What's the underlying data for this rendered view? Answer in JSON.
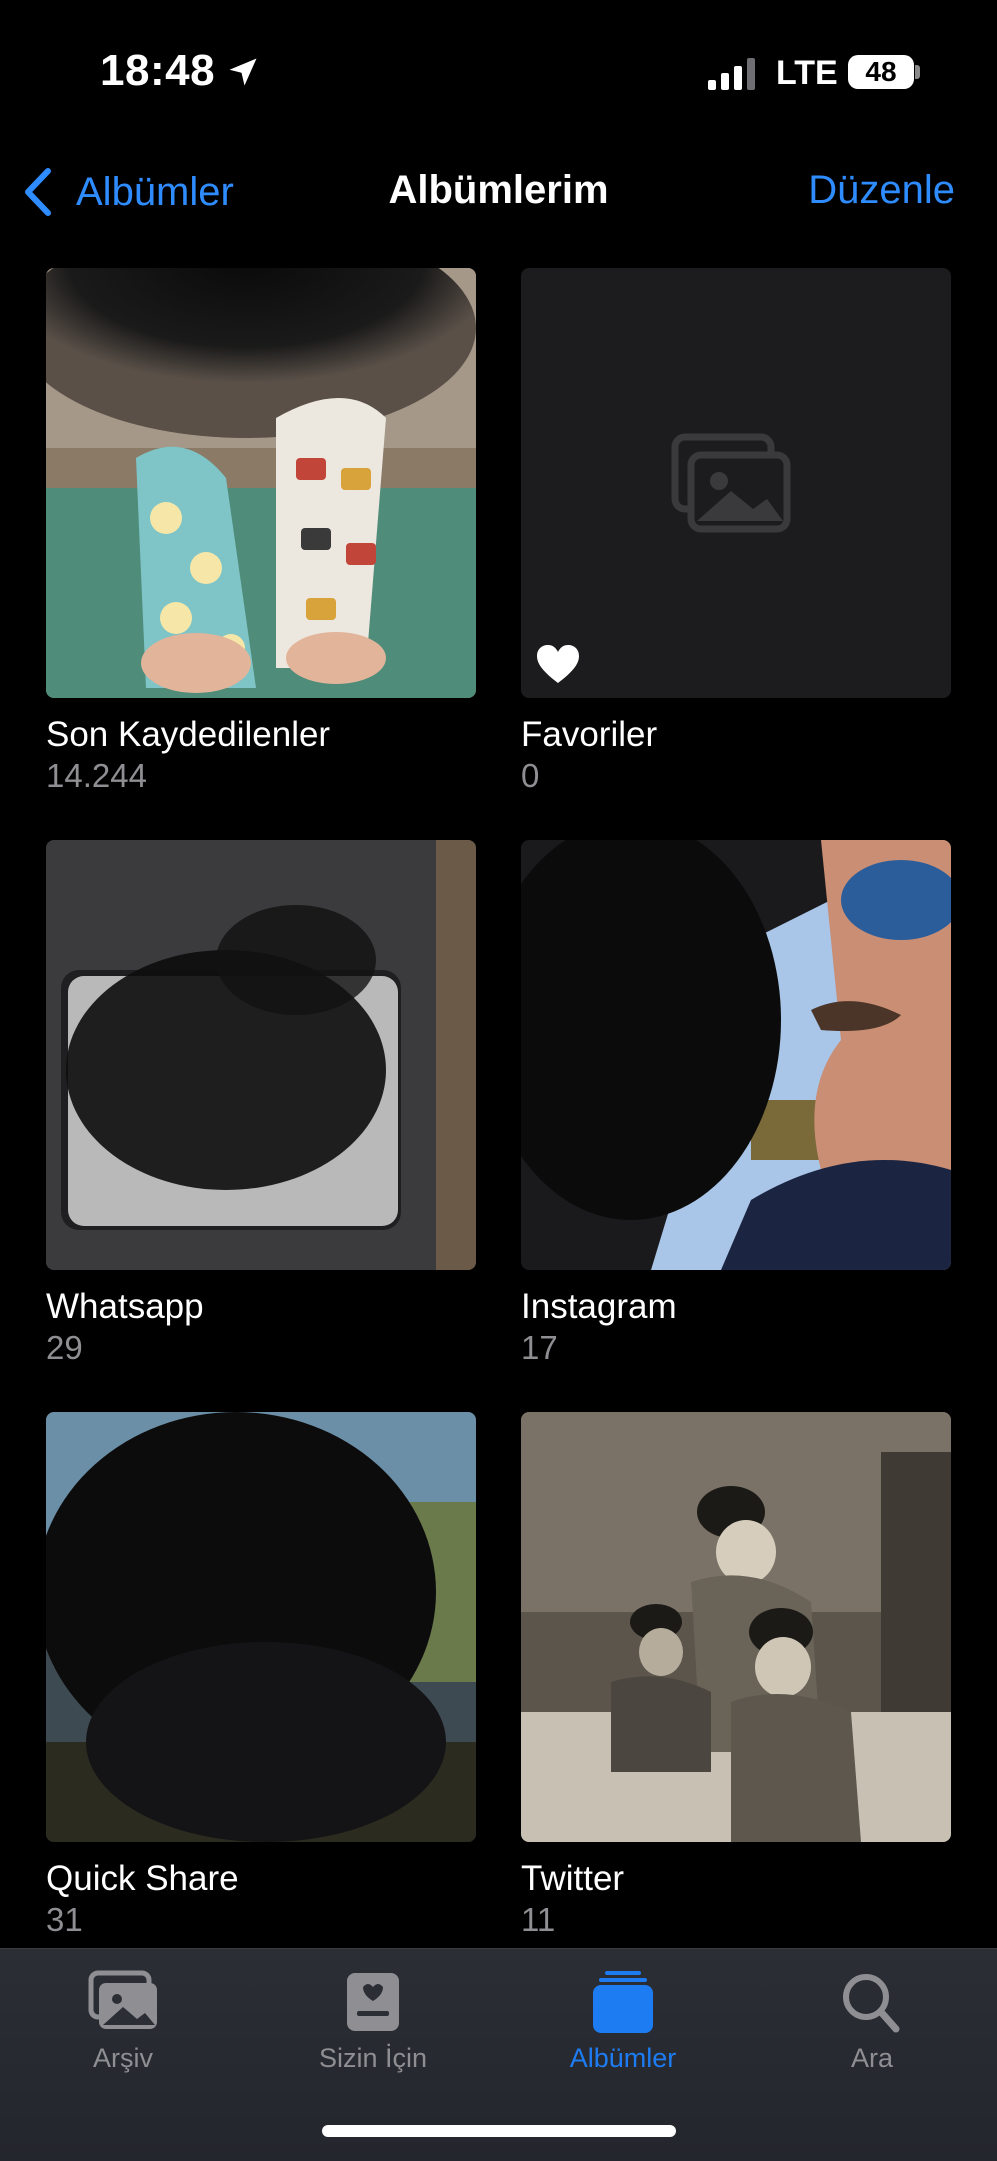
{
  "status_bar": {
    "time": "18:48",
    "network": "LTE",
    "battery": "48"
  },
  "nav": {
    "back_label": "Albümler",
    "title": "Albümlerim",
    "edit_label": "Düzenle"
  },
  "albums": [
    {
      "name": "Son Kaydedilenler",
      "count": "14.244"
    },
    {
      "name": "Favoriler",
      "count": "0"
    },
    {
      "name": "Whatsapp",
      "count": "29"
    },
    {
      "name": "Instagram",
      "count": "17"
    },
    {
      "name": "Quick Share",
      "count": "31"
    },
    {
      "name": "Twitter",
      "count": "11"
    }
  ],
  "tab_bar": {
    "tabs": [
      {
        "label": "Arşiv",
        "icon": "photo-library-icon"
      },
      {
        "label": "Sizin İçin",
        "icon": "for-you-icon"
      },
      {
        "label": "Albümler",
        "icon": "albums-icon"
      },
      {
        "label": "Ara",
        "icon": "search-icon"
      }
    ],
    "active_index": 2
  },
  "colors": {
    "accent": "#2f8cff",
    "background": "#000000",
    "secondary_text": "#8e8e93"
  }
}
